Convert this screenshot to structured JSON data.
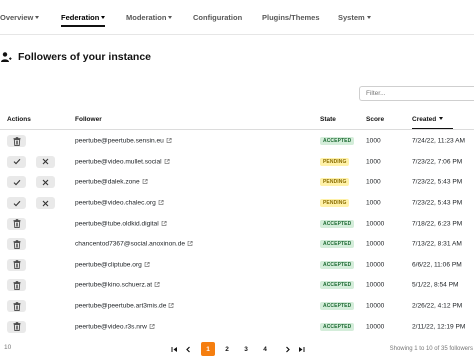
{
  "nav": {
    "items": [
      {
        "label": "Overview",
        "dropdown": true
      },
      {
        "label": "Federation",
        "dropdown": true,
        "active": true
      },
      {
        "label": "Moderation",
        "dropdown": true
      },
      {
        "label": "Configuration",
        "dropdown": false
      },
      {
        "label": "Plugins/Themes",
        "dropdown": false
      },
      {
        "label": "System",
        "dropdown": true
      }
    ]
  },
  "page": {
    "title": "Followers of your instance",
    "title_icon": "followers-icon"
  },
  "filter": {
    "placeholder": "Filter..."
  },
  "table": {
    "headers": {
      "actions": "Actions",
      "follower": "Follower",
      "state": "State",
      "score": "Score",
      "created": "Created"
    },
    "sort_column": "created",
    "sort_direction": "desc",
    "rows": [
      {
        "follower": "peertube@peertube.sensin.eu",
        "state": "ACCEPTED",
        "score": "1000",
        "created": "7/24/22, 11:23 AM",
        "actions": [
          "delete"
        ]
      },
      {
        "follower": "peertube@video.mullet.social",
        "state": "PENDING",
        "score": "1000",
        "created": "7/23/22, 7:06 PM",
        "actions": [
          "accept",
          "reject"
        ]
      },
      {
        "follower": "peertube@dalek.zone",
        "state": "PENDING",
        "score": "1000",
        "created": "7/23/22, 5:43 PM",
        "actions": [
          "accept",
          "reject"
        ]
      },
      {
        "follower": "peertube@video.chalec.org",
        "state": "PENDING",
        "score": "1000",
        "created": "7/23/22, 5:43 PM",
        "actions": [
          "accept",
          "reject"
        ]
      },
      {
        "follower": "peertube@tube.oldkid.digital",
        "state": "ACCEPTED",
        "score": "10000",
        "created": "7/18/22, 6:23 PM",
        "actions": [
          "delete"
        ]
      },
      {
        "follower": "chancentod7367@social.anoxinon.de",
        "state": "ACCEPTED",
        "score": "10000",
        "created": "7/13/22, 8:31 AM",
        "actions": [
          "delete"
        ]
      },
      {
        "follower": "peertube@cliptube.org",
        "state": "ACCEPTED",
        "score": "10000",
        "created": "6/6/22, 11:06 PM",
        "actions": [
          "delete"
        ]
      },
      {
        "follower": "peertube@kino.schuerz.at",
        "state": "ACCEPTED",
        "score": "10000",
        "created": "5/1/22, 8:54 PM",
        "actions": [
          "delete"
        ]
      },
      {
        "follower": "peertube@peertube.art3mis.de",
        "state": "ACCEPTED",
        "score": "10000",
        "created": "2/26/22, 4:12 PM",
        "actions": [
          "delete"
        ]
      },
      {
        "follower": "peertube@video.r3s.nrw",
        "state": "ACCEPTED",
        "score": "10000",
        "created": "2/11/22, 12:19 PM",
        "actions": [
          "delete"
        ]
      }
    ]
  },
  "pagination": {
    "page_size": "10",
    "pages": [
      "1",
      "2",
      "3",
      "4"
    ],
    "current_page": "1",
    "showing_text": "Showing 1 to 10 of 35 followers"
  },
  "colors": {
    "accent": "#f57e0f",
    "accepted_bg": "#d4edda",
    "pending_bg": "#fff1a8"
  }
}
